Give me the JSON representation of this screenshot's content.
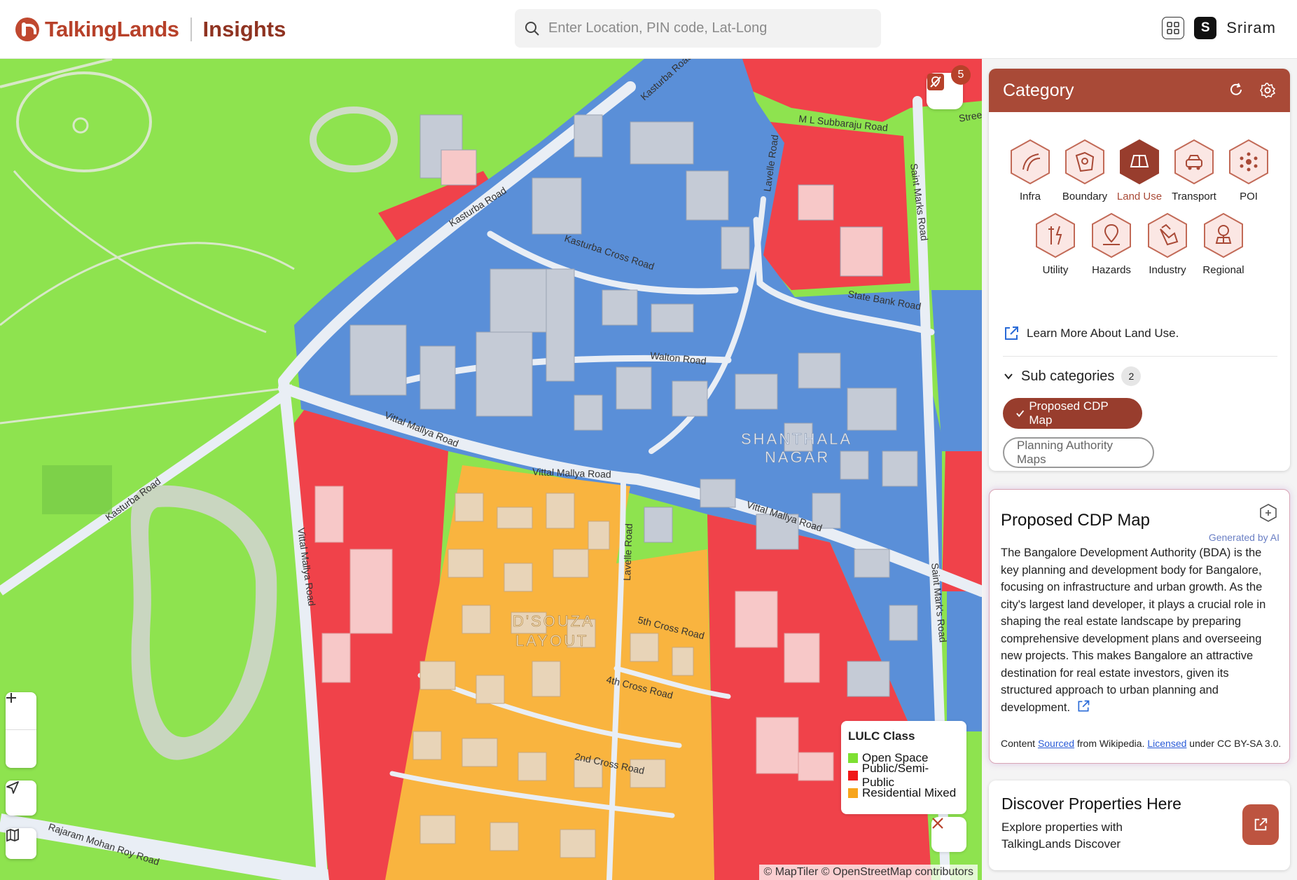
{
  "header": {
    "brand": "TalkingLands",
    "product": "Insights",
    "search_placeholder": "Enter Location, PIN code, Lat-Long",
    "user_initial": "S",
    "user_name": "Sriram"
  },
  "map": {
    "marker_count": "5",
    "labels": {
      "shanthala": "SHANTHALA",
      "nagar": "NAGAR",
      "dsouza": "D'SOUZA",
      "layout": "LAYOUT",
      "kasturba_road_1": "Kasturba Road",
      "kasturba_road_2": "Kasturba Road",
      "kasturba_road_3": "Kasturba Road",
      "kasturba_cross_road": "Kasturba Cross Road",
      "ml_subbaraju_road": "M L Subbaraju Road",
      "lavelle_road_1": "Lavelle Road",
      "lavelle_road_2": "Lavelle Road",
      "saint_marks_road_1": "Saint Marks Road",
      "saint_marks_road_2": "Saint Mark's Road",
      "state_bank_road": "State Bank Road",
      "walton_road": "Walton Road",
      "vittal_mallya_road_1": "Vittal Mallya Road",
      "vittal_mallya_road_2": "Vittal Mallya Road",
      "vittal_mallya_road_3": "Vittal Mallya Road",
      "vittal_mallya_road_4": "Vittal Mallya Road",
      "fifth_cross_road": "5th Cross Road",
      "fourth_cross_road": "4th Cross Road",
      "second_cross_road": "2nd Cross Road",
      "rajaram_mohan_roy_road": "Rajaram Mohan Roy Road",
      "street": "Street"
    },
    "legend": {
      "title": "LULC Class",
      "items": [
        {
          "label": "Open Space",
          "color": "#7ee032"
        },
        {
          "label": "Public/Semi-Public",
          "color": "#f01818"
        },
        {
          "label": "Residential Mixed",
          "color": "#f7a51c"
        }
      ]
    },
    "attribution": "© MapTiler © OpenStreetMap contributors",
    "colors": {
      "open_space": "#8ee34f",
      "public": "#f0424a",
      "residential": "#f9b43f",
      "commercial": "#5a8fd8",
      "road": "#e9eef5",
      "building": "#c5cbd6"
    }
  },
  "category": {
    "title": "Category",
    "items": [
      {
        "label": "Infra",
        "icon": "infra-icon",
        "active": false
      },
      {
        "label": "Boundary",
        "icon": "boundary-icon",
        "active": false
      },
      {
        "label": "Land Use",
        "icon": "land-use-icon",
        "active": true
      },
      {
        "label": "Transport",
        "icon": "transport-icon",
        "active": false
      },
      {
        "label": "POI",
        "icon": "poi-icon",
        "active": false
      },
      {
        "label": "Utility",
        "icon": "utility-icon",
        "active": false
      },
      {
        "label": "Hazards",
        "icon": "hazards-icon",
        "active": false
      },
      {
        "label": "Industry",
        "icon": "industry-icon",
        "active": false
      },
      {
        "label": "Regional",
        "icon": "regional-icon",
        "active": false
      }
    ],
    "learn_more": "Learn More About Land Use.",
    "subcategories_label": "Sub categories",
    "subcategories_count": "2",
    "chip_active": "Proposed CDP Map",
    "chip_inactive": "Planning Authority Maps",
    "accent": "#a94a37"
  },
  "cdp": {
    "title": "Proposed CDP Map",
    "ai_label": "Generated by AI",
    "body": "The Bangalore Development Authority (BDA) is the key planning and development body for Bangalore, focusing on infrastructure and urban growth. As the city's largest land developer, it plays a crucial role in shaping the real estate landscape by preparing comprehensive development plans and overseeing new projects. This makes Bangalore an attractive destination for real estate investors, given its structured approach to urban planning and development.",
    "source_prefix": "Content ",
    "source_link": "Sourced",
    "source_mid": " from Wikipedia. ",
    "license_link": "Licensed",
    "license_suffix": " under CC BY-SA 3.0."
  },
  "discover": {
    "title": "Discover Properties Here",
    "text": "Explore properties with TalkingLands Discover"
  }
}
